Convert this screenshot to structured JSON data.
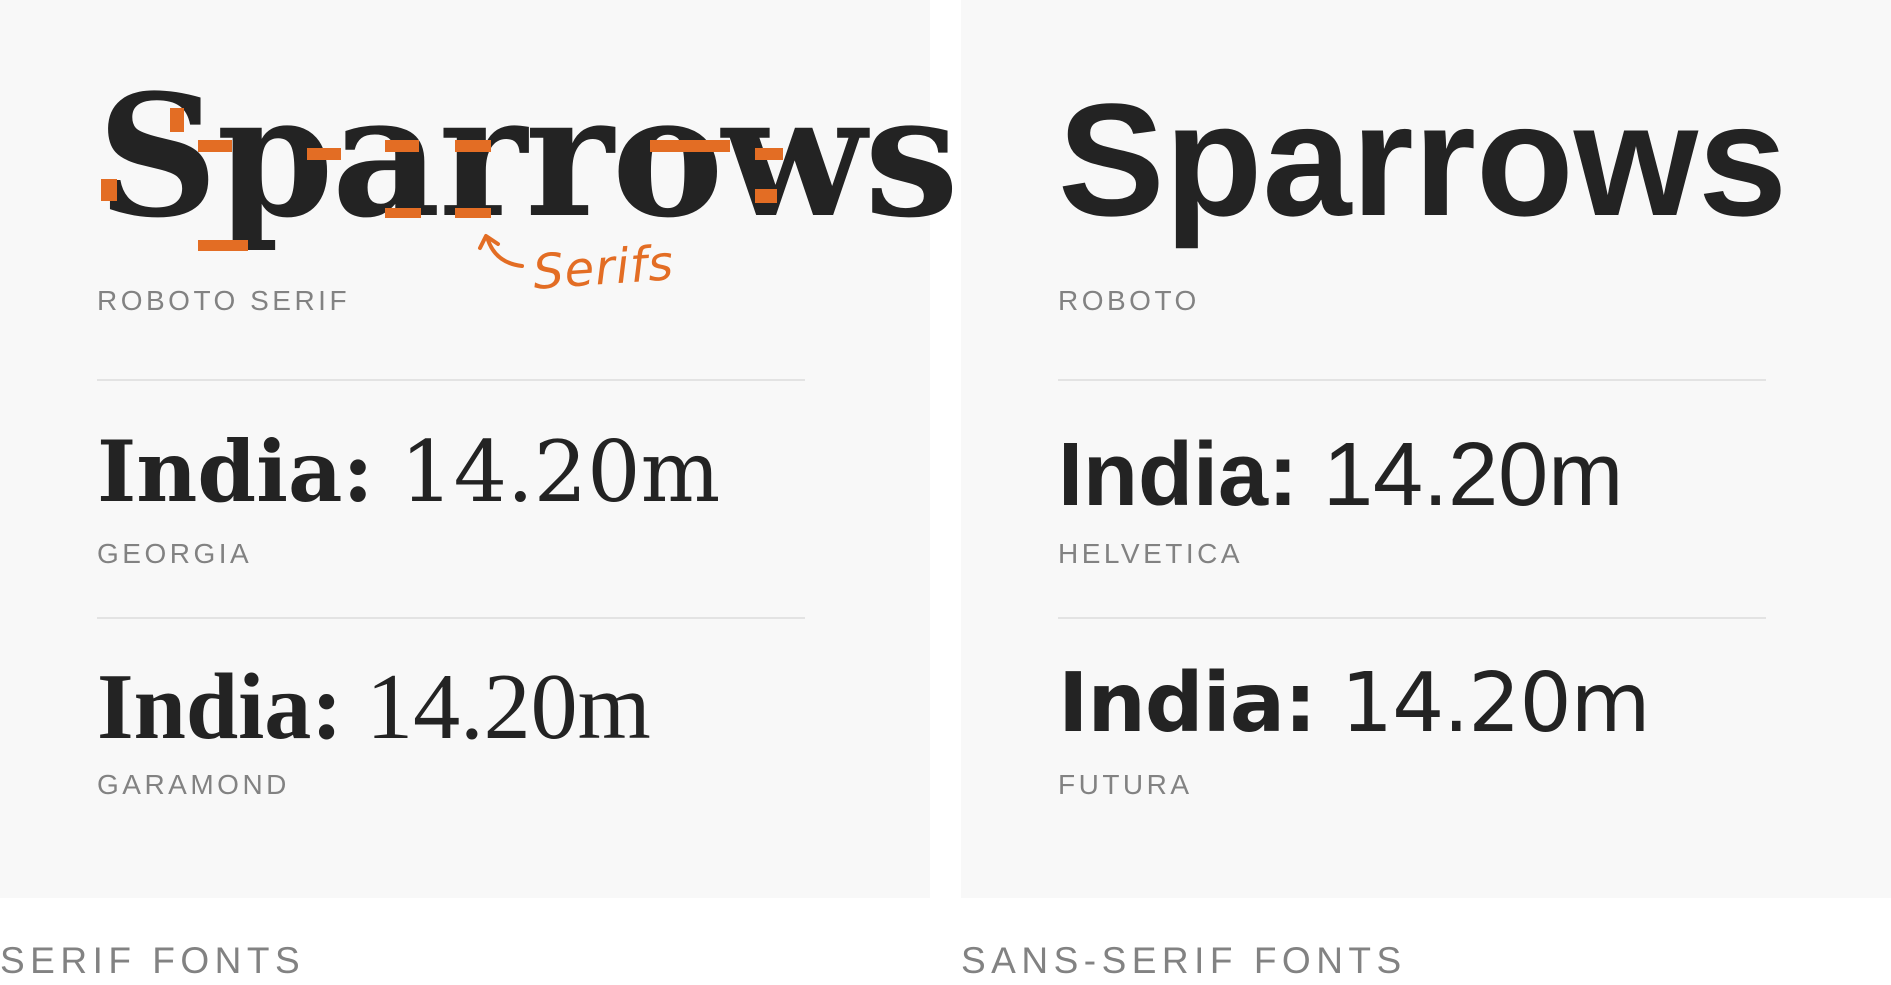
{
  "colors": {
    "panel_background": "#f8f8f8",
    "text_dark": "#232323",
    "label_gray": "#828282",
    "divider": "#e3e3e3",
    "accent_orange": "#e36d24"
  },
  "serif_panel": {
    "sample_word": "Sparrows",
    "sample_word_label": "ROBOTO SERIF",
    "annotation": "Serifs",
    "annotation_icon": "curved-arrow-icon",
    "samples": [
      {
        "lead": "India:",
        "rest": " 14.20m",
        "label": "GEORGIA"
      },
      {
        "lead": "India:",
        "rest": " 14.20m",
        "label": "GARAMOND"
      }
    ],
    "caption": "SERIF FONTS"
  },
  "sans_panel": {
    "sample_word": "Sparrows",
    "sample_word_label": "ROBOTO",
    "samples": [
      {
        "lead": "India:",
        "rest": " 14.20m",
        "label": "HELVETICA"
      },
      {
        "lead": "India:",
        "rest": " 14.20m",
        "label": "FUTURA"
      }
    ],
    "caption": "SANS-SERIF FONTS"
  }
}
